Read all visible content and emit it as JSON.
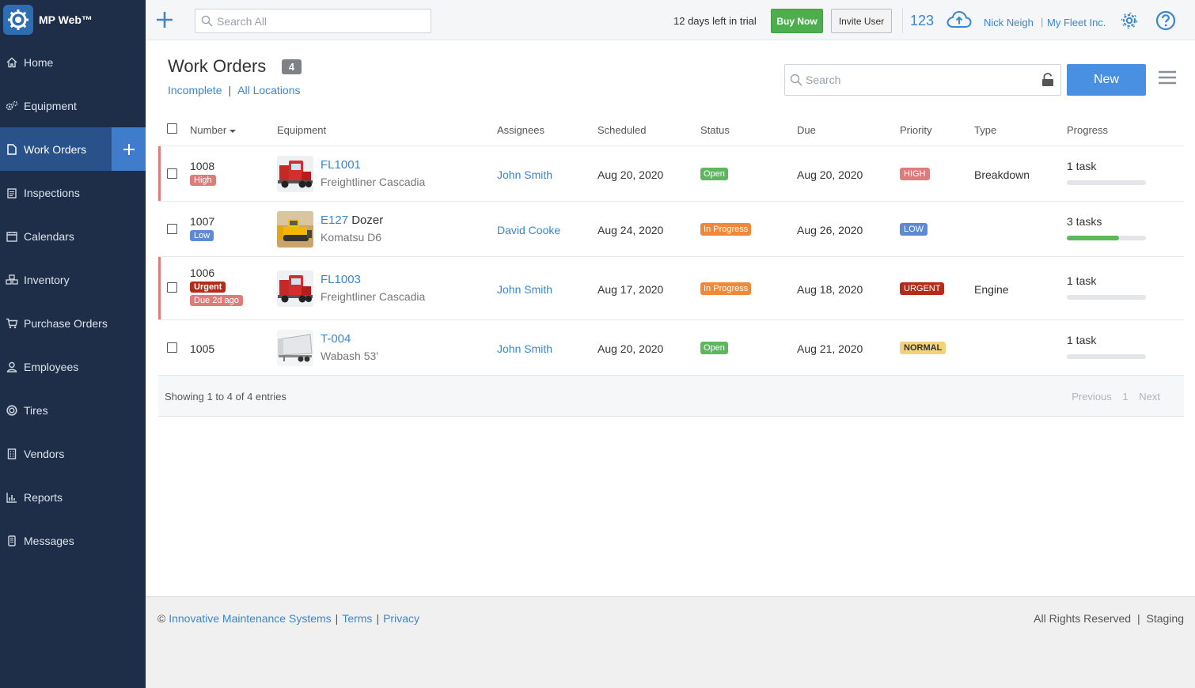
{
  "brand": {
    "name": "MP Web™"
  },
  "sidebar": {
    "items": [
      {
        "label": "Home",
        "icon": "home-icon"
      },
      {
        "label": "Equipment",
        "icon": "gears-icon"
      },
      {
        "label": "Work Orders",
        "icon": "document-icon",
        "active": true
      },
      {
        "label": "Inspections",
        "icon": "clipboard-icon"
      },
      {
        "label": "Calendars",
        "icon": "calendar-icon"
      },
      {
        "label": "Inventory",
        "icon": "cubes-icon"
      },
      {
        "label": "Purchase Orders",
        "icon": "cart-icon"
      },
      {
        "label": "Employees",
        "icon": "user-icon"
      },
      {
        "label": "Tires",
        "icon": "tire-icon"
      },
      {
        "label": "Vendors",
        "icon": "building-icon"
      },
      {
        "label": "Reports",
        "icon": "chart-icon"
      },
      {
        "label": "Messages",
        "icon": "phone-icon"
      }
    ]
  },
  "topbar": {
    "search_placeholder": "Search All",
    "trial_text": "12 days left in trial",
    "buy_label": "Buy Now",
    "invite_label": "Invite User",
    "count": "123",
    "user_name": "Nick Neigh",
    "user_sep": "|",
    "company": "My Fleet Inc."
  },
  "page": {
    "title": "Work Orders",
    "count": "4",
    "filter_status": "Incomplete",
    "filter_sep": "|",
    "filter_location": "All Locations",
    "search_placeholder": "Search",
    "new_label": "New"
  },
  "table": {
    "columns": {
      "number": "Number",
      "equipment": "Equipment",
      "assignees": "Assignees",
      "scheduled": "Scheduled",
      "status": "Status",
      "due": "Due",
      "priority": "Priority",
      "type": "Type",
      "progress": "Progress"
    },
    "rows": [
      {
        "number": "1008",
        "tag": "High",
        "eq_id": "FL1001",
        "eq_suffix": "",
        "eq_model": "Freightliner Cascadia",
        "assignee": "John Smith",
        "scheduled": "Aug 20, 2020",
        "status": "Open",
        "due": "Aug 20, 2020",
        "priority": "HIGH",
        "type": "Breakdown",
        "progress_text": "1 task",
        "progress": 0
      },
      {
        "number": "1007",
        "tag": "Low",
        "eq_id": "E127",
        "eq_suffix": " Dozer",
        "eq_model": "Komatsu D6",
        "assignee": "David Cooke",
        "scheduled": "Aug 24, 2020",
        "status": "In Progress",
        "due": "Aug 26, 2020",
        "priority": "LOW",
        "type": "",
        "progress_text": "3 tasks",
        "progress": 0.66
      },
      {
        "number": "1006",
        "tag": "Urgent",
        "tag2": "Due 2d ago",
        "eq_id": "FL1003",
        "eq_suffix": "",
        "eq_model": "Freightliner Cascadia",
        "assignee": "John Smith",
        "scheduled": "Aug 17, 2020",
        "status": "In Progress",
        "due": "Aug 18, 2020",
        "priority": "URGENT",
        "type": "Engine",
        "progress_text": "1 task",
        "progress": 0
      },
      {
        "number": "1005",
        "tag": "",
        "eq_id": "T-004",
        "eq_suffix": "",
        "eq_model": "Wabash 53'",
        "assignee": "John Smith",
        "scheduled": "Aug 20, 2020",
        "status": "Open",
        "due": "Aug 21, 2020",
        "priority": "NORMAL",
        "type": "",
        "progress_text": "1 task",
        "progress": 0
      }
    ],
    "showing": "Showing 1 to 4 of 4 entries",
    "pager": {
      "previous": "Previous",
      "page": "1",
      "next": "Next"
    }
  },
  "footer": {
    "copyright": "©",
    "company_link": "Innovative Maintenance Systems",
    "sep": "|",
    "terms": "Terms",
    "privacy": "Privacy",
    "rights": "All Rights Reserved",
    "env": "Staging"
  },
  "colors": {
    "sidebar_bg": "#1e2e48",
    "active_nav": "#29528a",
    "accent": "#4a90e2",
    "link": "#3a86d0",
    "success": "#5cb85c",
    "warning": "#f0883a",
    "danger": "#b52a18"
  }
}
